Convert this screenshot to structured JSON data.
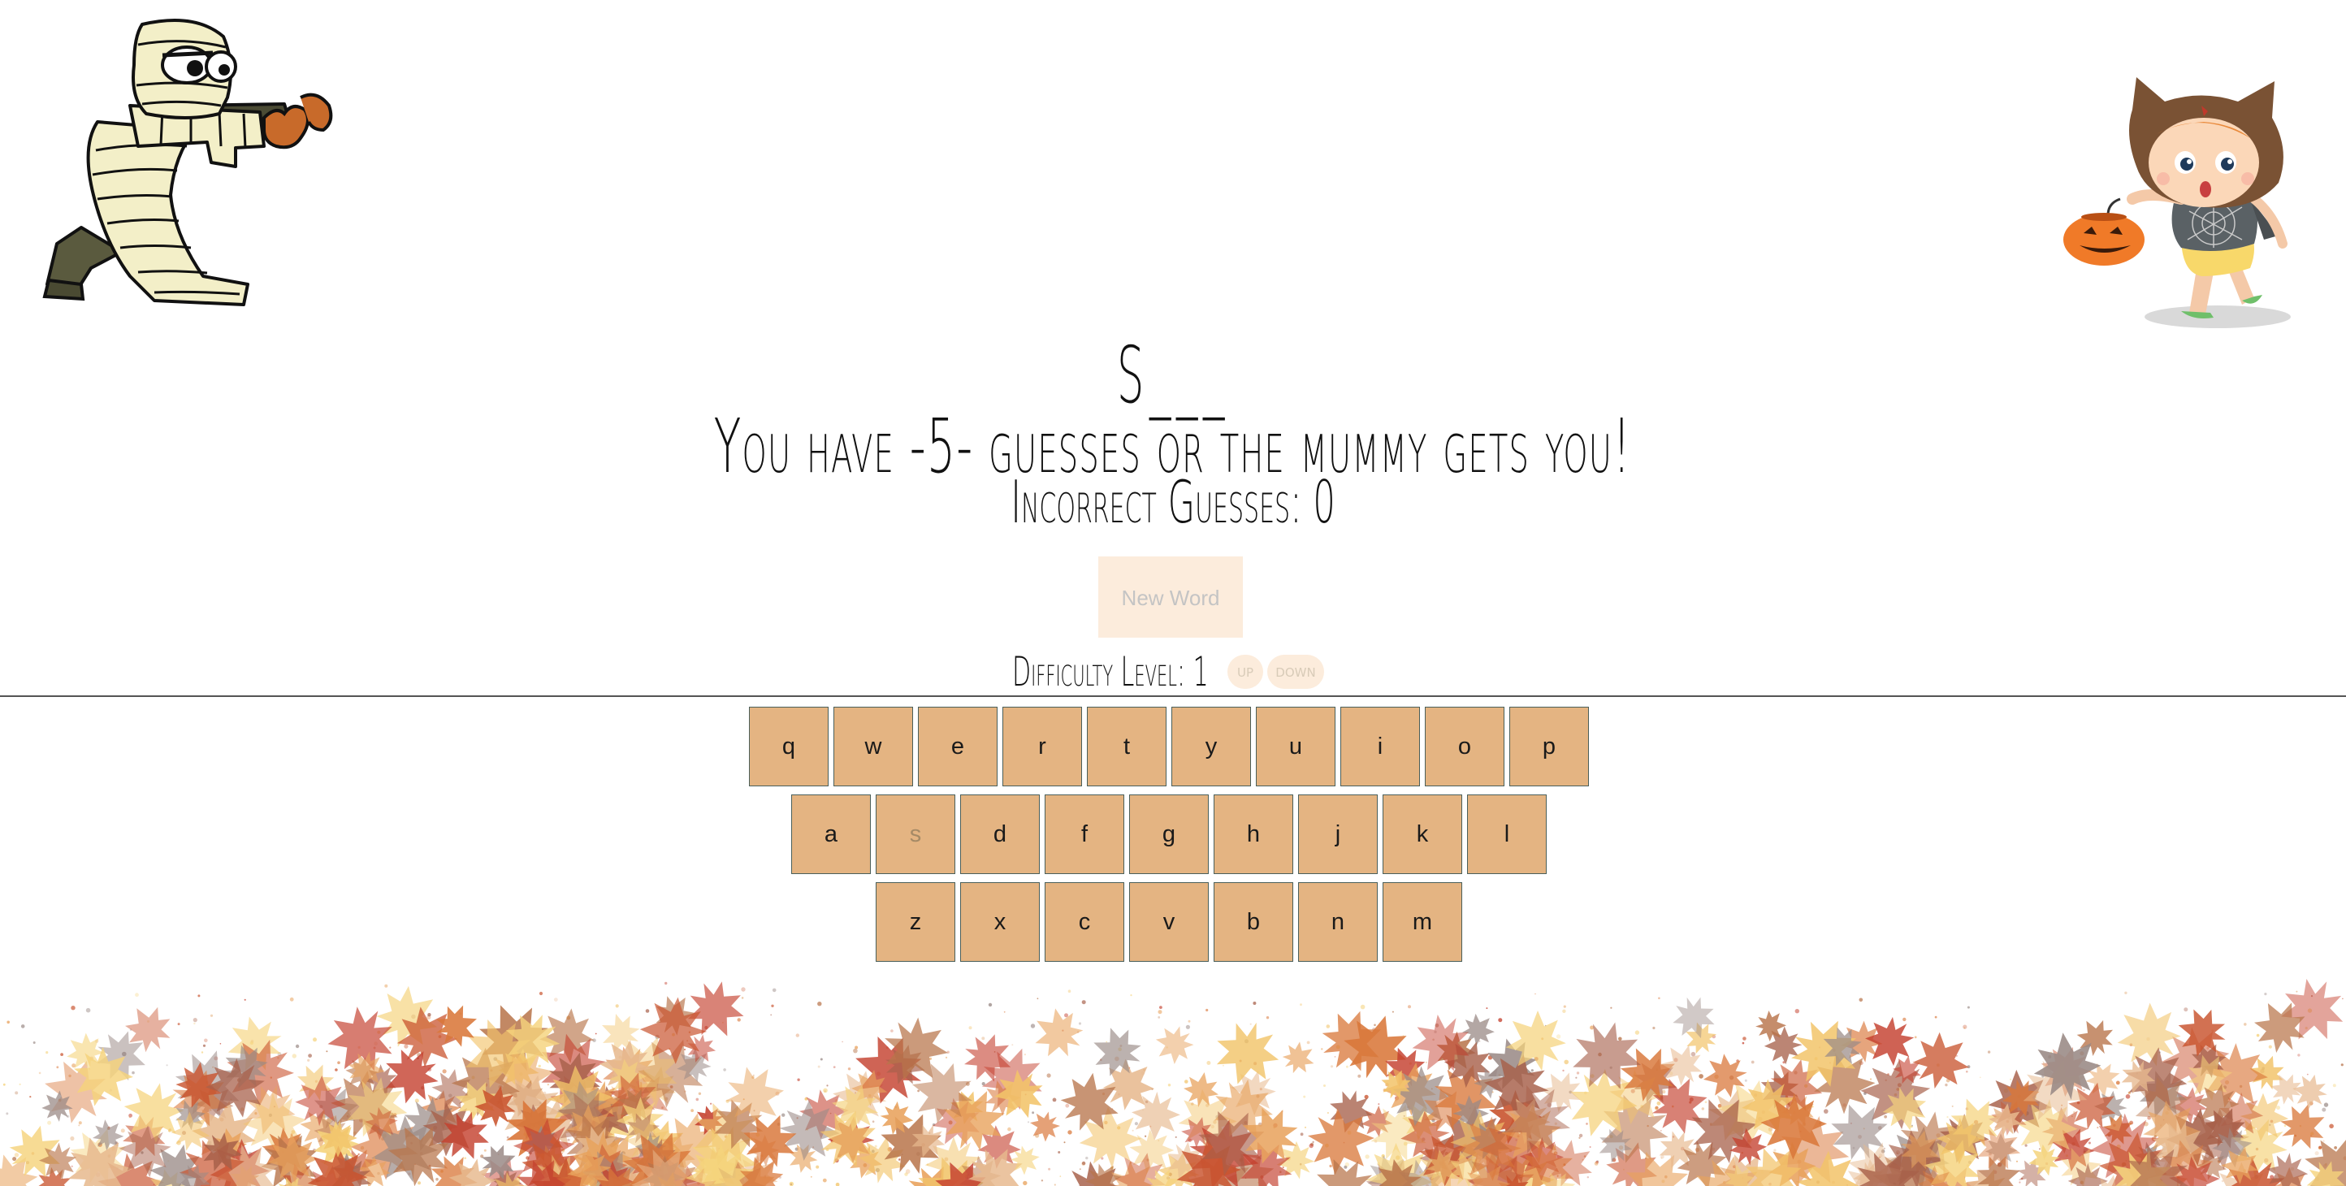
{
  "game": {
    "word_display": "S___",
    "guesses_message": "You have -5- guesses or the mummy gets you!",
    "incorrect_label": "Incorrect Guesses: 0",
    "new_word_label": "New Word",
    "difficulty_label": "Difficulty Level: 1",
    "up_label": "up",
    "down_label": "down"
  },
  "keyboard": {
    "rows": [
      [
        "q",
        "w",
        "e",
        "r",
        "t",
        "y",
        "u",
        "i",
        "o",
        "p"
      ],
      [
        "a",
        "s",
        "d",
        "f",
        "g",
        "h",
        "j",
        "k",
        "l"
      ],
      [
        "z",
        "x",
        "c",
        "v",
        "b",
        "n",
        "m"
      ]
    ],
    "used": [
      "s"
    ]
  },
  "icons": {
    "left_character": "mummy-icon",
    "right_character": "cat-costume-kid-icon",
    "decoration": "autumn-leaves"
  },
  "colors": {
    "key_fill": "#e4b482",
    "key_border": "#4a5f5a",
    "button_fill": "#fcecdc",
    "pumpkin": "#f07a28",
    "mummy_wrap": "#f3efc8"
  }
}
